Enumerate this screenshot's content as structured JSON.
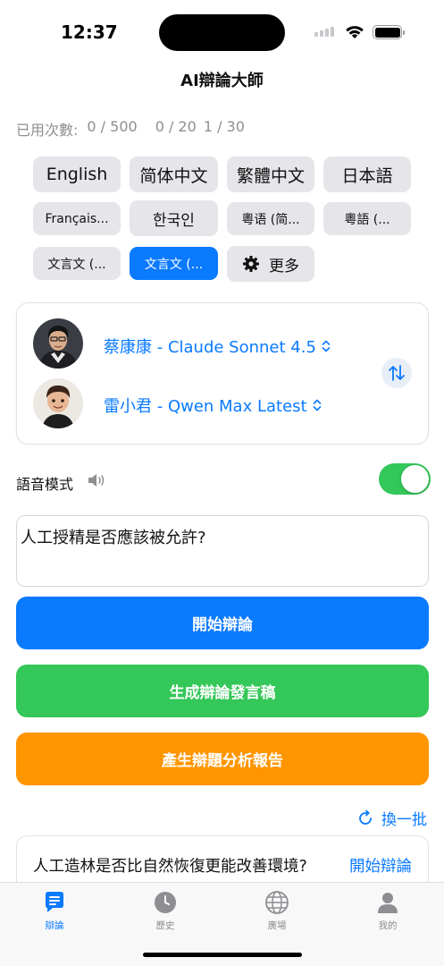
{
  "status_bar": {
    "time": "12:37"
  },
  "app": {
    "title": "AI辯論大師"
  },
  "usage": {
    "label": "已用次數:",
    "count_a": "0 / 500",
    "count_b": "0 / 20",
    "count_c": "1 / 30"
  },
  "languages": [
    {
      "label": "English",
      "selected": false
    },
    {
      "label": "简体中文",
      "selected": false
    },
    {
      "label": "繁體中文",
      "selected": false
    },
    {
      "label": "日本語",
      "selected": false
    },
    {
      "label": "Françai​s...",
      "selected": false
    },
    {
      "label": "한국인",
      "selected": false
    },
    {
      "label": "粵语 (简...",
      "selected": false
    },
    {
      "label": "粵語 (...",
      "selected": false
    },
    {
      "label": "文言文 (...",
      "selected": false
    },
    {
      "label": "文言文 (...",
      "selected": true
    },
    {
      "label": "更多",
      "selected": false,
      "icon": "gear-icon"
    }
  ],
  "debaters": [
    {
      "label": "蔡康康 - Claude Sonnet 4.5",
      "avatar": "avatar-man-icon"
    },
    {
      "label": "雷小君 - Qwen Max Latest",
      "avatar": "avatar-child-icon"
    }
  ],
  "voice": {
    "label": "語音模式",
    "enabled": true
  },
  "topic": {
    "value": "人工授精是否應該被允許?"
  },
  "actions": {
    "start": "開始辯論",
    "speech": "生成辯論發言稿",
    "report": "產生辯題分析報告"
  },
  "suggestions": {
    "refresh_label": "換一批",
    "items": [
      {
        "text": "人工造林是否比自然恢復更能改善環境?",
        "action": "開始辯論"
      }
    ]
  },
  "tabs": [
    {
      "label": "辯論",
      "icon": "chat-icon",
      "active": true
    },
    {
      "label": "歷史",
      "icon": "clock-icon",
      "active": false
    },
    {
      "label": "廣場",
      "icon": "globe-icon",
      "active": false
    },
    {
      "label": "我的",
      "icon": "person-icon",
      "active": false
    }
  ],
  "colors": {
    "accent": "#0a7aff",
    "green": "#34c759",
    "orange": "#ff9500"
  }
}
